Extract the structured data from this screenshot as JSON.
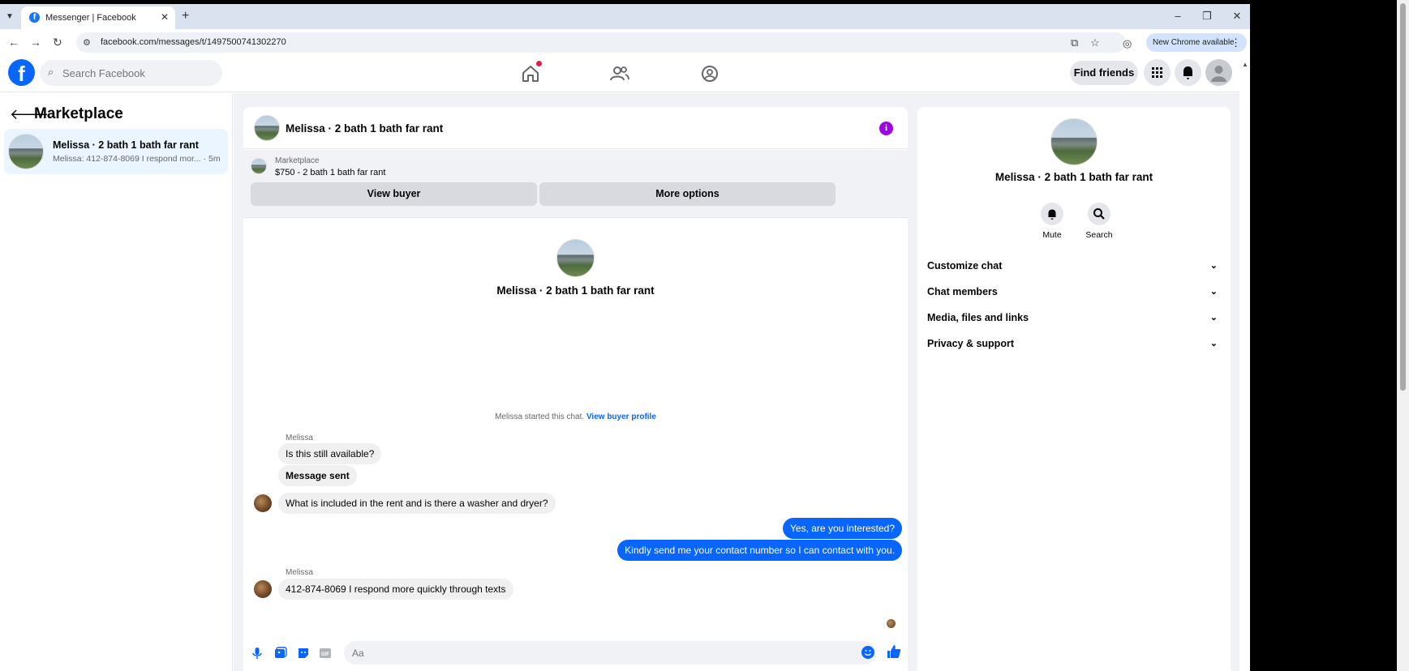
{
  "browser": {
    "tab_title": "Messenger | Facebook",
    "url": "facebook.com/messages/t/1497500741302270",
    "new_chrome": "New Chrome available"
  },
  "fb": {
    "search_placeholder": "Search Facebook",
    "find_friends": "Find friends"
  },
  "left": {
    "title": "Marketplace",
    "conversations": [
      {
        "name": "Melissa · 2 bath 1 bath far rant",
        "snippet": "Melissa: 412-874-8069 I respond mor... · 5m"
      }
    ]
  },
  "chat": {
    "title": "Melissa · 2 bath 1 bath far rant",
    "marketplace_label": "Marketplace",
    "listing": "$750 - 2 bath 1 bath far rant",
    "view_buyer": "View buyer",
    "more_options": "More options",
    "intro_name": "Melissa · 2 bath 1 bath far rant",
    "started_text": "Melissa started this chat.",
    "view_buyer_profile": "View buyer profile",
    "sender1": "Melissa",
    "msg1": "Is this still available?",
    "msg2": "Message sent",
    "msg3": "What is included in the rent and is there a washer and dryer?",
    "out1": "Yes, are you interested?",
    "out2": "Kindly send me your contact number so I can contact with you.",
    "sender2": "Melissa",
    "msg4": "412-874-8069 I respond more quickly through texts",
    "composer_placeholder": "Aa"
  },
  "right": {
    "name": "Melissa · 2 bath 1 bath far rant",
    "mute": "Mute",
    "search": "Search",
    "sections": [
      "Customize chat",
      "Chat members",
      "Media, files and links",
      "Privacy & support"
    ]
  },
  "colors": {
    "accent": "#0866ff",
    "info": "#9d05e6"
  }
}
